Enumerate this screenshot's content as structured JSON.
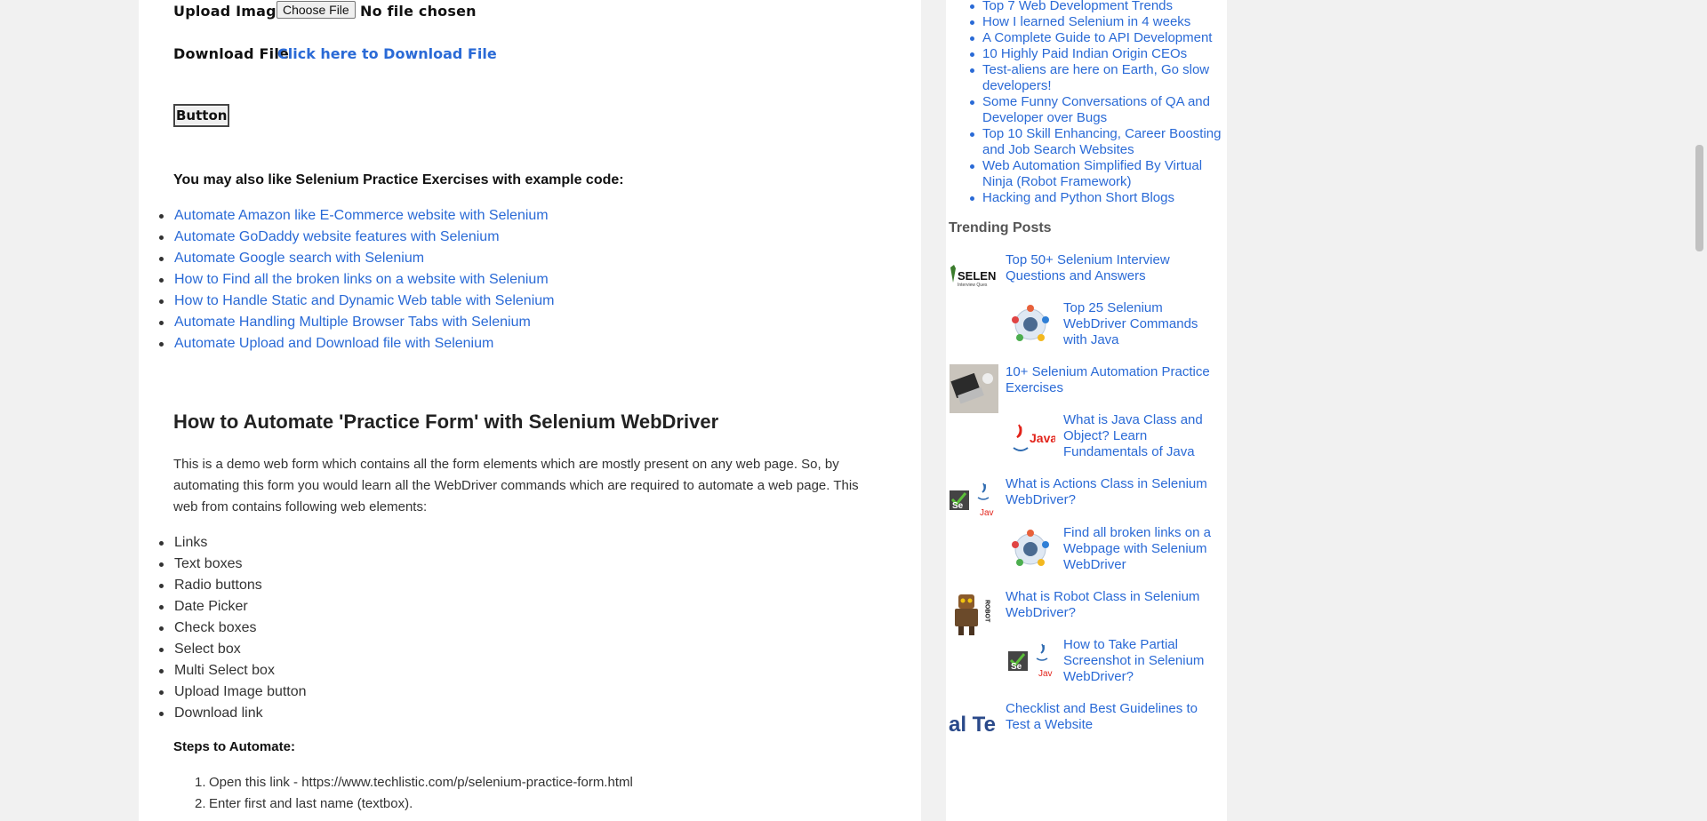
{
  "form": {
    "upload_label": "Upload Image",
    "choose_file_label": "Choose File",
    "no_file_text": "No file chosen",
    "download_label": "Download File",
    "download_link": "Click here to Download File",
    "button_label": "Button"
  },
  "exercises": {
    "heading": "You may also like Selenium Practice Exercises with example code:",
    "items": [
      "Automate Amazon like E-Commerce website with Selenium",
      "Automate GoDaddy website features with Selenium",
      "Automate Google search with Selenium",
      "How to Find all the broken links on a website with Selenium",
      "How to Handle Static and Dynamic Web table with Selenium",
      "Automate Handling Multiple Browser Tabs with Selenium",
      "Automate Upload and Download file with Selenium"
    ]
  },
  "article": {
    "title": "How to Automate 'Practice Form' with Selenium WebDriver",
    "intro_line1": "This is a demo web form which contains all the form elements which are mostly present on any web page. So, by",
    "intro_line2": "automating this form you would learn all the WebDriver commands which are required to automate a web page. This",
    "intro_line3": "web from contains following web elements:",
    "elements": [
      "Links",
      "Text boxes",
      "Radio buttons",
      "Date Picker",
      "Check boxes",
      "Select box",
      "Multi Select box",
      "Upload Image button",
      "Download link"
    ],
    "steps_heading": "Steps to Automate:",
    "steps": [
      "Open this link - https://www.techlistic.com/p/selenium-practice-form.html",
      "Enter first and last name (textbox)."
    ]
  },
  "sidebar": {
    "popular_links": [
      "Top 7 Web Development Trends",
      "How I learned Selenium in 4 weeks",
      "A Complete Guide to API Development",
      "10 Highly Paid Indian Origin CEOs",
      [
        "Test-aliens are here on Earth, Go slow",
        "developers!"
      ],
      [
        "Some Funny Conversations of QA and",
        "Developer over Bugs"
      ],
      [
        "Top 10 Skill Enhancing, Career Boosting",
        "and Job Search Websites"
      ],
      [
        "Web Automation Simplified By Virtual",
        "Ninja (Robot Framework)"
      ],
      "Hacking and Python Short Blogs"
    ],
    "trending_heading": "Trending Posts",
    "trending": [
      {
        "lines": [
          "Top 50+ Selenium Interview",
          "Questions and Answers"
        ],
        "icon": "selenium-logo-icon"
      },
      {
        "lines": [
          "Top 25 Selenium",
          "WebDriver Commands",
          "with Java"
        ],
        "icon": "webdriver-browsers-icon"
      },
      {
        "lines": [
          "10+ Selenium Automation Practice",
          "Exercises"
        ],
        "icon": "laptop-photo-icon"
      },
      {
        "lines": [
          "What is Java Class and",
          "Object? Learn",
          "Fundamentals of Java"
        ],
        "icon": "java-logo-icon"
      },
      {
        "lines": [
          "What is Actions Class in Selenium",
          "WebDriver?"
        ],
        "icon": "selenium-java-icon"
      },
      {
        "lines": [
          "Find all broken links on a",
          "Webpage with Selenium",
          "WebDriver"
        ],
        "icon": "webdriver-browsers-icon"
      },
      {
        "lines": [
          "What is Robot Class in Selenium",
          "WebDriver?"
        ],
        "icon": "robot-icon"
      },
      {
        "lines": [
          "How to Take Partial",
          "Screenshot in Selenium",
          "WebDriver?"
        ],
        "icon": "selenium-java-icon"
      },
      {
        "lines": [
          "Checklist and Best Guidelines to",
          "Test a Website"
        ],
        "icon": "test-text-icon"
      }
    ],
    "thumb_text": {
      "selenium": "SELENIU",
      "selenium_sub": "Interview Ques",
      "java": "Java",
      "jav": "Jav",
      "se": "Se",
      "robot": "ROBOT",
      "test": "al Te"
    }
  },
  "colors": {
    "link": "#2a6ad6",
    "page_bg": "#f1f1f1",
    "content_bg": "#ffffff"
  }
}
